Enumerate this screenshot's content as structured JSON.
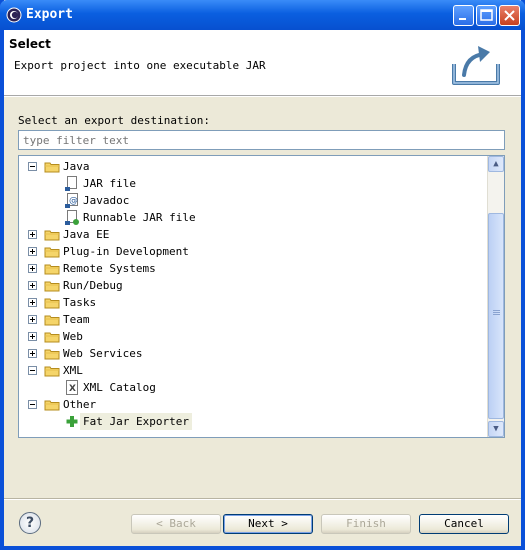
{
  "window": {
    "title": "Export"
  },
  "header": {
    "title": "Select",
    "description": "Export project into one executable JAR"
  },
  "destination_label": "Select an export destination:",
  "filter": {
    "placeholder": "type filter text"
  },
  "tree": [
    {
      "label": "Java",
      "level": 0,
      "expanded": true,
      "icon": "folder-icon"
    },
    {
      "label": "JAR file",
      "level": 1,
      "icon": "jar-file-icon"
    },
    {
      "label": "Javadoc",
      "level": 1,
      "icon": "javadoc-icon"
    },
    {
      "label": "Runnable JAR file",
      "level": 1,
      "icon": "runnable-jar-icon"
    },
    {
      "label": "Java EE",
      "level": 0,
      "expanded": false,
      "icon": "folder-icon"
    },
    {
      "label": "Plug-in Development",
      "level": 0,
      "expanded": false,
      "icon": "folder-icon"
    },
    {
      "label": "Remote Systems",
      "level": 0,
      "expanded": false,
      "icon": "folder-icon"
    },
    {
      "label": "Run/Debug",
      "level": 0,
      "expanded": false,
      "icon": "folder-icon"
    },
    {
      "label": "Tasks",
      "level": 0,
      "expanded": false,
      "icon": "folder-icon"
    },
    {
      "label": "Team",
      "level": 0,
      "expanded": false,
      "icon": "folder-icon"
    },
    {
      "label": "Web",
      "level": 0,
      "expanded": false,
      "icon": "folder-icon"
    },
    {
      "label": "Web Services",
      "level": 0,
      "expanded": false,
      "icon": "folder-icon"
    },
    {
      "label": "XML",
      "level": 0,
      "expanded": true,
      "icon": "folder-icon"
    },
    {
      "label": "XML Catalog",
      "level": 1,
      "icon": "xml-catalog-icon"
    },
    {
      "label": "Other",
      "level": 0,
      "expanded": true,
      "icon": "folder-icon"
    },
    {
      "label": "Fat Jar Exporter",
      "level": 1,
      "icon": "fat-jar-icon",
      "selected": true
    }
  ],
  "buttons": {
    "back": "< Back",
    "next": "Next >",
    "finish": "Finish",
    "cancel": "Cancel"
  },
  "colors": {
    "titlebar": "#0a5fe0",
    "dialog_bg": "#ece9d8",
    "selection": "#eeeede"
  }
}
